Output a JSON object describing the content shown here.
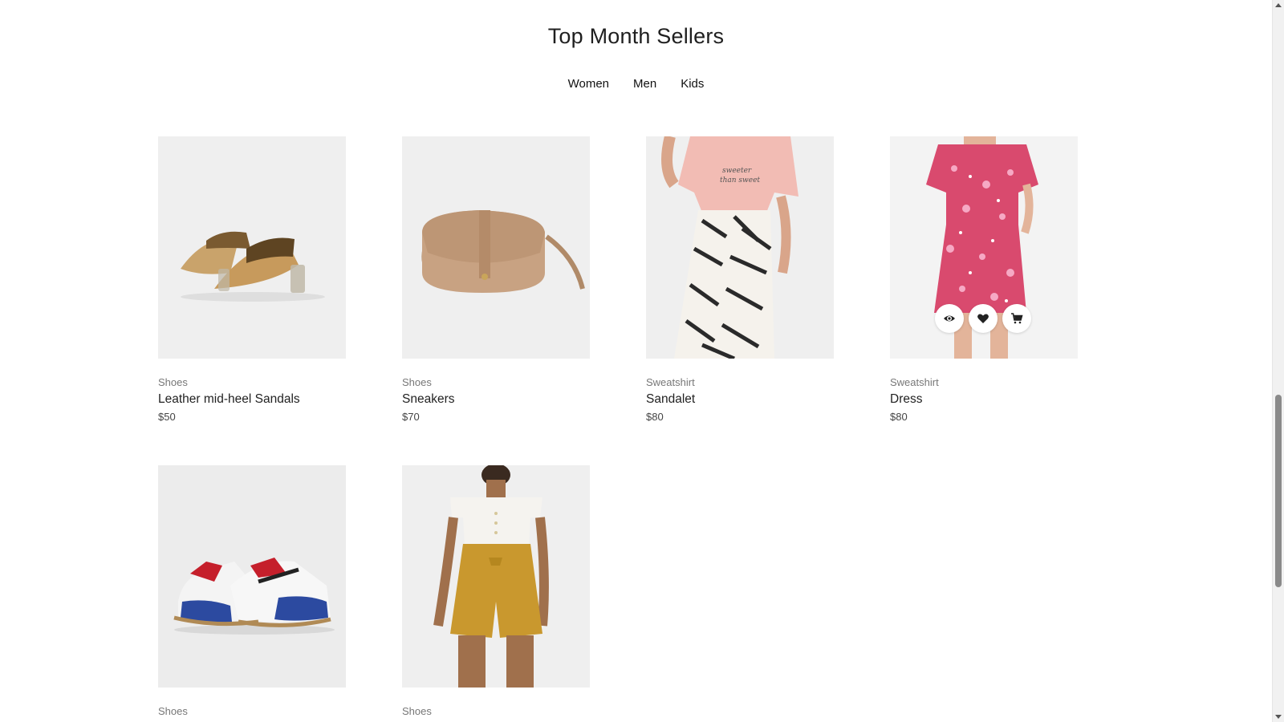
{
  "section": {
    "title": "Top Month Sellers",
    "tabs": [
      "Women",
      "Men",
      "Kids"
    ]
  },
  "products": [
    {
      "category": "Shoes",
      "name": "Leather mid-heel Sandals",
      "price": "$50",
      "image_icon": "sandals-image"
    },
    {
      "category": "Shoes",
      "name": "Sneakers",
      "price": "$70",
      "image_icon": "handbag-image"
    },
    {
      "category": "Sweatshirt",
      "name": "Sandalet",
      "price": "$80",
      "image_icon": "tshirt-skirt-image"
    },
    {
      "category": "Sweatshirt",
      "name": "Dress",
      "price": "$80",
      "image_icon": "floral-dress-image"
    },
    {
      "category": "Shoes",
      "image_icon": "sneakers-image"
    },
    {
      "category": "Shoes",
      "image_icon": "top-shorts-image"
    }
  ],
  "hover_actions": {
    "icons": [
      "eye-icon",
      "heart-icon",
      "cart-icon"
    ]
  },
  "colors": {
    "card_bg": "#efefef",
    "title": "#1f1f1f",
    "muted": "#777777"
  }
}
